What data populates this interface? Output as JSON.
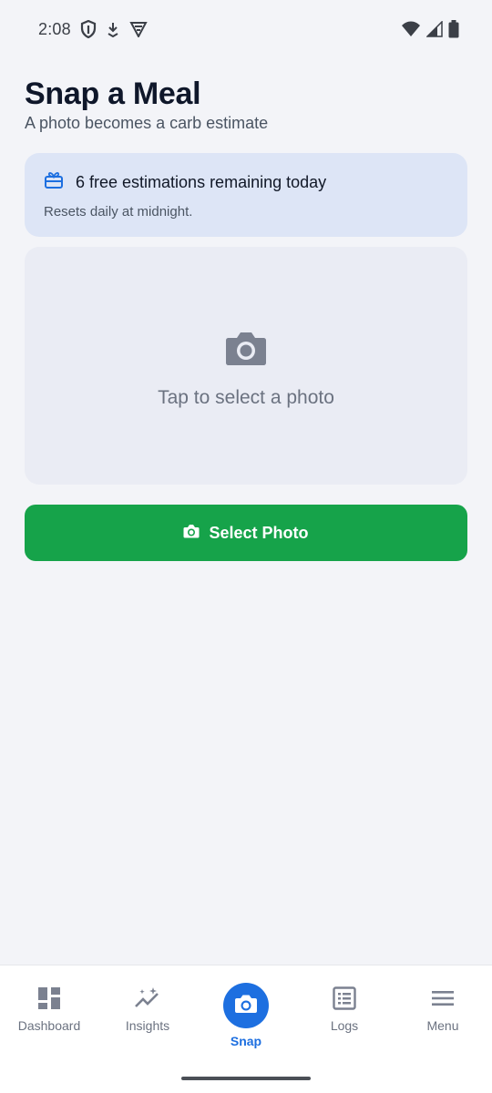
{
  "status_bar": {
    "time": "2:08",
    "icons": [
      "shield-icon",
      "download-icon",
      "vpn-icon",
      "wifi-icon",
      "signal-icon",
      "battery-icon"
    ]
  },
  "header": {
    "title": "Snap a Meal",
    "subtitle": "A photo becomes a carb estimate"
  },
  "quota": {
    "icon": "gift-icon",
    "title": "6 free estimations remaining today",
    "note": "Resets daily at midnight."
  },
  "photo_area": {
    "icon": "camera-icon",
    "hint": "Tap to select a photo"
  },
  "select_button": {
    "icon": "camera-icon",
    "label": "Select Photo"
  },
  "nav": {
    "items": [
      {
        "label": "Dashboard",
        "icon": "dashboard-icon",
        "active": false
      },
      {
        "label": "Insights",
        "icon": "insights-icon",
        "active": false
      },
      {
        "label": "Snap",
        "icon": "camera-icon",
        "active": true
      },
      {
        "label": "Logs",
        "icon": "logs-icon",
        "active": false
      },
      {
        "label": "Menu",
        "icon": "menu-icon",
        "active": false
      }
    ]
  },
  "colors": {
    "background": "#f3f4f8",
    "accent_blue": "#1d6fe0",
    "primary_green": "#16a34a",
    "quota_bg": "#dde5f6",
    "photo_area_bg": "#eaecf4",
    "muted_icon": "#7b8190"
  }
}
